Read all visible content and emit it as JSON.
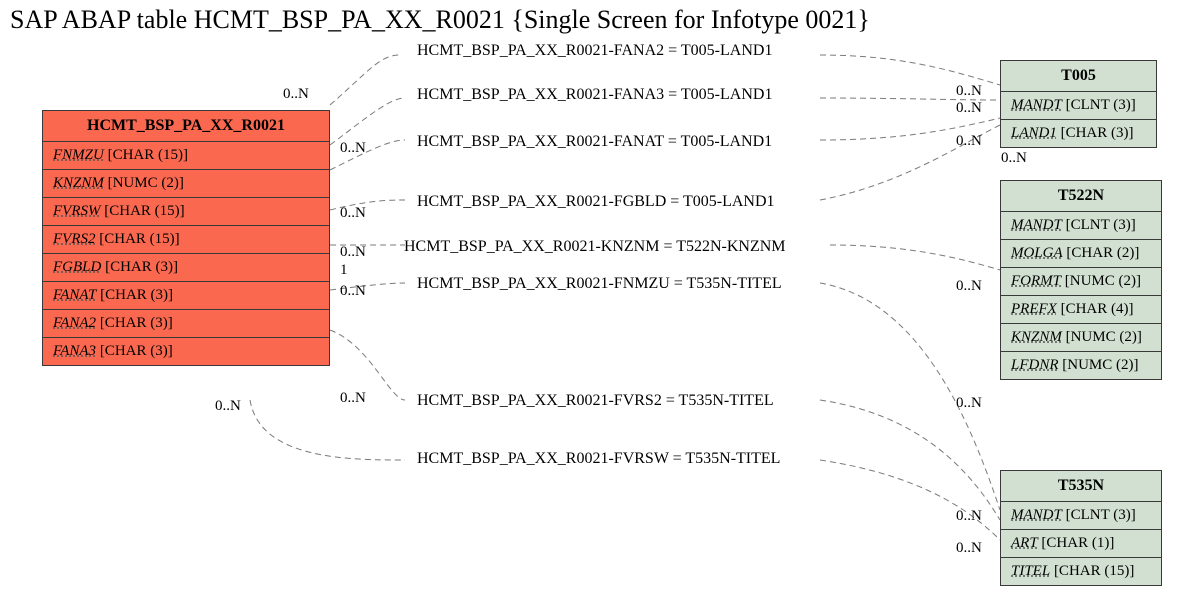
{
  "title": "SAP ABAP table HCMT_BSP_PA_XX_R0021 {Single Screen for Infotype 0021}",
  "tables": {
    "main": {
      "name": "HCMT_BSP_PA_XX_R0021",
      "fields": [
        {
          "f": "FNMZU",
          "t": "[CHAR (15)]"
        },
        {
          "f": "KNZNM",
          "t": "[NUMC (2)]"
        },
        {
          "f": "FVRSW",
          "t": "[CHAR (15)]"
        },
        {
          "f": "FVRS2",
          "t": "[CHAR (15)]"
        },
        {
          "f": "FGBLD",
          "t": "[CHAR (3)]"
        },
        {
          "f": "FANAT",
          "t": "[CHAR (3)]"
        },
        {
          "f": "FANA2",
          "t": "[CHAR (3)]"
        },
        {
          "f": "FANA3",
          "t": "[CHAR (3)]"
        }
      ]
    },
    "t005": {
      "name": "T005",
      "fields": [
        {
          "f": "MANDT",
          "t": "[CLNT (3)]"
        },
        {
          "f": "LAND1",
          "t": "[CHAR (3)]"
        }
      ]
    },
    "t522n": {
      "name": "T522N",
      "fields": [
        {
          "f": "MANDT",
          "t": "[CLNT (3)]"
        },
        {
          "f": "MOLGA",
          "t": "[CHAR (2)]"
        },
        {
          "f": "FORMT",
          "t": "[NUMC (2)]"
        },
        {
          "f": "PREFX",
          "t": "[CHAR (4)]"
        },
        {
          "f": "KNZNM",
          "t": "[NUMC (2)]"
        },
        {
          "f": "LFDNR",
          "t": "[NUMC (2)]"
        }
      ]
    },
    "t535n": {
      "name": "T535N",
      "fields": [
        {
          "f": "MANDT",
          "t": "[CLNT (3)]"
        },
        {
          "f": "ART",
          "t": "[CHAR (1)]"
        },
        {
          "f": "TITEL",
          "t": "[CHAR (15)]"
        }
      ]
    }
  },
  "relations": [
    {
      "text": "HCMT_BSP_PA_XX_R0021-FANA2 = T005-LAND1"
    },
    {
      "text": "HCMT_BSP_PA_XX_R0021-FANA3 = T005-LAND1"
    },
    {
      "text": "HCMT_BSP_PA_XX_R0021-FANAT = T005-LAND1"
    },
    {
      "text": "HCMT_BSP_PA_XX_R0021-FGBLD = T005-LAND1"
    },
    {
      "text": "HCMT_BSP_PA_XX_R0021-KNZNM = T522N-KNZNM"
    },
    {
      "text": "HCMT_BSP_PA_XX_R0021-FNMZU = T535N-TITEL"
    },
    {
      "text": "HCMT_BSP_PA_XX_R0021-FVRS2 = T535N-TITEL"
    },
    {
      "text": "HCMT_BSP_PA_XX_R0021-FVRSW = T535N-TITEL"
    }
  ],
  "cards": {
    "c0": "0..N",
    "c1": "0..N",
    "c2": "0..N",
    "c3": "0..N",
    "c4": "0..N",
    "c5": "0..N",
    "c6": "0..N",
    "c7": "0..N",
    "c8": "0..N",
    "c9": "0..N",
    "c10": "0..N",
    "c11": "0..N",
    "c12": "0..N",
    "c13": "0..N",
    "c14": "0..N",
    "one": "1"
  },
  "chart_data": {
    "type": "erd",
    "entities": [
      {
        "name": "HCMT_BSP_PA_XX_R0021",
        "color": "#fb6850",
        "attributes": [
          "FNMZU CHAR(15)",
          "KNZNM NUMC(2)",
          "FVRSW CHAR(15)",
          "FVRS2 CHAR(15)",
          "FGBLD CHAR(3)",
          "FANAT CHAR(3)",
          "FANA2 CHAR(3)",
          "FANA3 CHAR(3)"
        ]
      },
      {
        "name": "T005",
        "color": "#d1e0d1",
        "attributes": [
          "MANDT CLNT(3)",
          "LAND1 CHAR(3)"
        ]
      },
      {
        "name": "T522N",
        "color": "#d1e0d1",
        "attributes": [
          "MANDT CLNT(3)",
          "MOLGA CHAR(2)",
          "FORMT NUMC(2)",
          "PREFX CHAR(4)",
          "KNZNM NUMC(2)",
          "LFDNR NUMC(2)"
        ]
      },
      {
        "name": "T535N",
        "color": "#d1e0d1",
        "attributes": [
          "MANDT CLNT(3)",
          "ART CHAR(1)",
          "TITEL CHAR(15)"
        ]
      }
    ],
    "relationships": [
      {
        "from": "HCMT_BSP_PA_XX_R0021.FANA2",
        "to": "T005.LAND1",
        "card_from": "0..N",
        "card_to": "0..N"
      },
      {
        "from": "HCMT_BSP_PA_XX_R0021.FANA3",
        "to": "T005.LAND1",
        "card_from": "0..N",
        "card_to": "0..N"
      },
      {
        "from": "HCMT_BSP_PA_XX_R0021.FANAT",
        "to": "T005.LAND1",
        "card_from": "0..N",
        "card_to": "0..N"
      },
      {
        "from": "HCMT_BSP_PA_XX_R0021.FGBLD",
        "to": "T005.LAND1",
        "card_from": "0..N",
        "card_to": "0..N"
      },
      {
        "from": "HCMT_BSP_PA_XX_R0021.KNZNM",
        "to": "T522N.KNZNM",
        "card_from": "1",
        "card_to": "0..N"
      },
      {
        "from": "HCMT_BSP_PA_XX_R0021.FNMZU",
        "to": "T535N.TITEL",
        "card_from": "0..N",
        "card_to": "0..N"
      },
      {
        "from": "HCMT_BSP_PA_XX_R0021.FVRS2",
        "to": "T535N.TITEL",
        "card_from": "0..N",
        "card_to": "0..N"
      },
      {
        "from": "HCMT_BSP_PA_XX_R0021.FVRSW",
        "to": "T535N.TITEL",
        "card_from": "0..N",
        "card_to": "0..N"
      }
    ]
  }
}
